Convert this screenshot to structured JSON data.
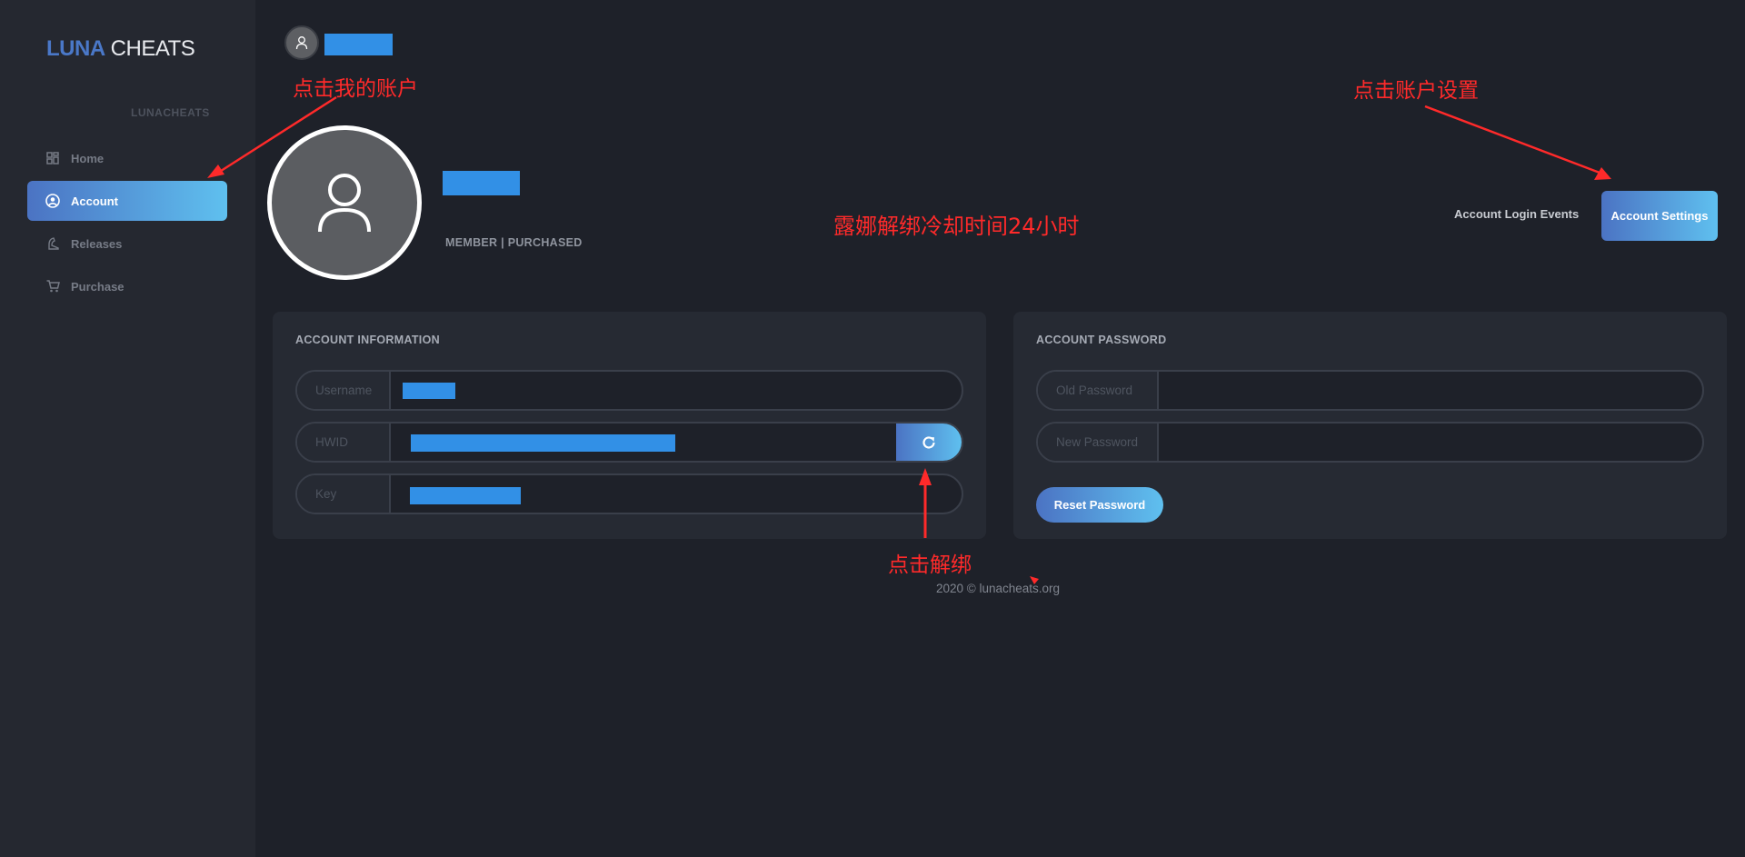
{
  "brand": {
    "part1": "LUNA",
    "part2": "CHEATS"
  },
  "sidebar": {
    "section_label": "LUNACHEATS",
    "items": [
      {
        "label": "Home",
        "icon": "grid-icon",
        "active": false
      },
      {
        "label": "Account",
        "icon": "user-circle-icon",
        "active": true
      },
      {
        "label": "Releases",
        "icon": "rocket-icon",
        "active": false
      },
      {
        "label": "Purchase",
        "icon": "cart-icon",
        "active": false
      }
    ]
  },
  "profile": {
    "role": "MEMBER | PURCHASED"
  },
  "header": {
    "login_events_label": "Account Login Events",
    "settings_label": "Account Settings"
  },
  "annotations": {
    "click_my_account": "点击我的账户",
    "click_account_settings": "点击账户设置",
    "cooldown_note": "露娜解绑冷却时间24小时",
    "click_unbind": "点击解绑"
  },
  "account_info": {
    "title": "ACCOUNT INFORMATION",
    "username_label": "Username",
    "hwid_label": "HWID",
    "key_label": "Key"
  },
  "account_password": {
    "title": "ACCOUNT PASSWORD",
    "old_password_label": "Old Password",
    "new_password_label": "New Password",
    "reset_label": "Reset Password"
  },
  "footer": {
    "text": "2020 © lunacheats.org"
  },
  "colors": {
    "accent_start": "#4b73c3",
    "accent_end": "#5fc0ef",
    "annotation": "#ff2a2a",
    "redaction": "#3290e6"
  }
}
